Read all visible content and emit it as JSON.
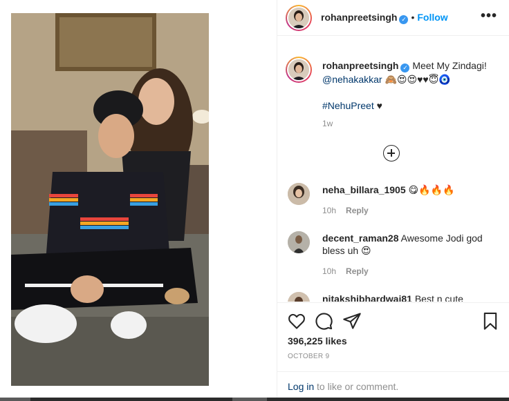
{
  "post": {
    "author": "rohanpreetsingh",
    "follow_label": "Follow",
    "more_label": "•••",
    "caption": {
      "author": "rohanpreetsingh",
      "text_line1": "Meet My Zindagi!",
      "mention": "@nehakakkar",
      "emojis_line": "🙈😍😍♥♥😇🧿",
      "hashtag": "#NehuPreet",
      "hashtag_suffix": "♥",
      "time": "1w"
    },
    "comments": [
      {
        "user": "neha_billara_1905",
        "text": "😋🔥🔥🔥",
        "time": "10h",
        "reply_label": "Reply"
      },
      {
        "user": "decent_raman28",
        "text": "Awesome Jodi god bless uh 😍",
        "time": "10h",
        "reply_label": "Reply"
      },
      {
        "user": "nitakshibhardwaj81",
        "text": "Best n cute"
      }
    ],
    "likes": "396,225 likes",
    "date": "OCTOBER 9",
    "login_link": "Log in",
    "login_suffix": "to like or comment."
  },
  "icons": {
    "verified": "verified-badge-icon",
    "like": "heart-icon",
    "comment": "comment-bubble-icon",
    "share": "paper-plane-icon",
    "save": "bookmark-icon",
    "load_more": "plus-circle-icon"
  },
  "colors": {
    "link_blue": "#0095f6",
    "text": "#262626",
    "muted": "#8e8e8e",
    "mention": "#00376b"
  }
}
